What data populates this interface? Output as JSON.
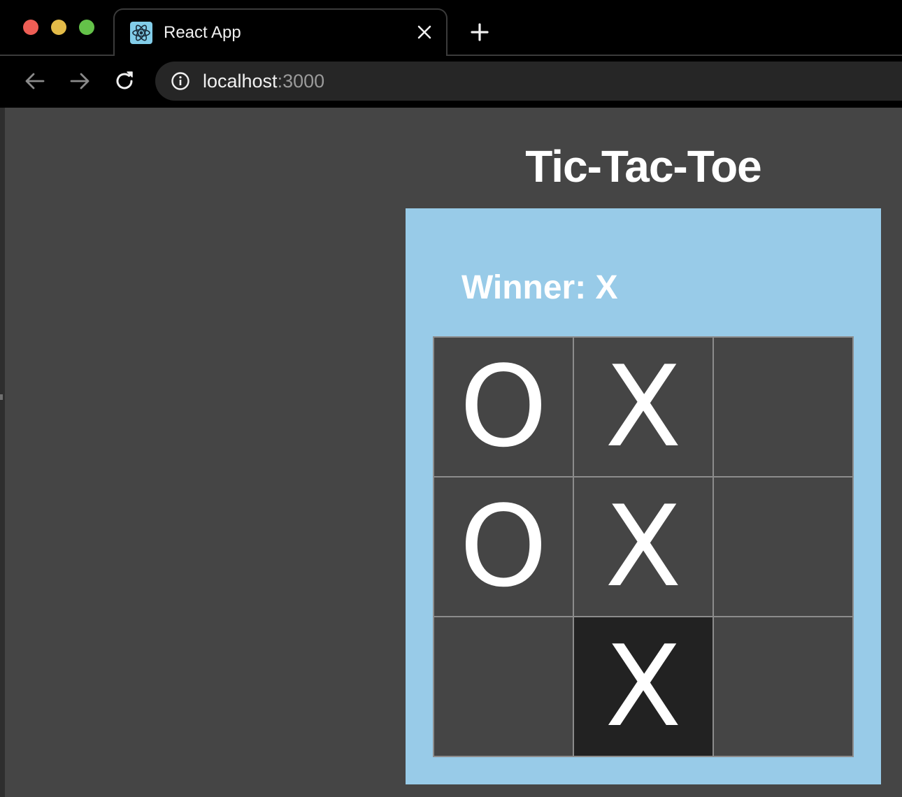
{
  "browser": {
    "tab": {
      "title": "React App"
    },
    "omnibox": {
      "host": "localhost",
      "port": ":3000"
    }
  },
  "page": {
    "title": "Tic-Tac-Toe",
    "status": "Winner: X",
    "board": [
      {
        "value": "O",
        "highlighted": false
      },
      {
        "value": "X",
        "highlighted": false
      },
      {
        "value": "",
        "highlighted": false
      },
      {
        "value": "O",
        "highlighted": false
      },
      {
        "value": "X",
        "highlighted": false
      },
      {
        "value": "",
        "highlighted": false
      },
      {
        "value": "",
        "highlighted": false
      },
      {
        "value": "X",
        "highlighted": true
      },
      {
        "value": "",
        "highlighted": false
      }
    ]
  },
  "colors": {
    "page_background": "#454545",
    "panel_background": "#98cbe8",
    "square_background": "#454545",
    "square_highlight": "#222222",
    "square_border": "#8c8c8c",
    "text": "#ffffff"
  },
  "icons": {
    "favicon": "react-logo-icon",
    "close": "close-icon",
    "new_tab": "plus-icon",
    "back": "arrow-left-icon",
    "forward": "arrow-right-icon",
    "reload": "reload-icon",
    "site_info": "info-icon"
  }
}
